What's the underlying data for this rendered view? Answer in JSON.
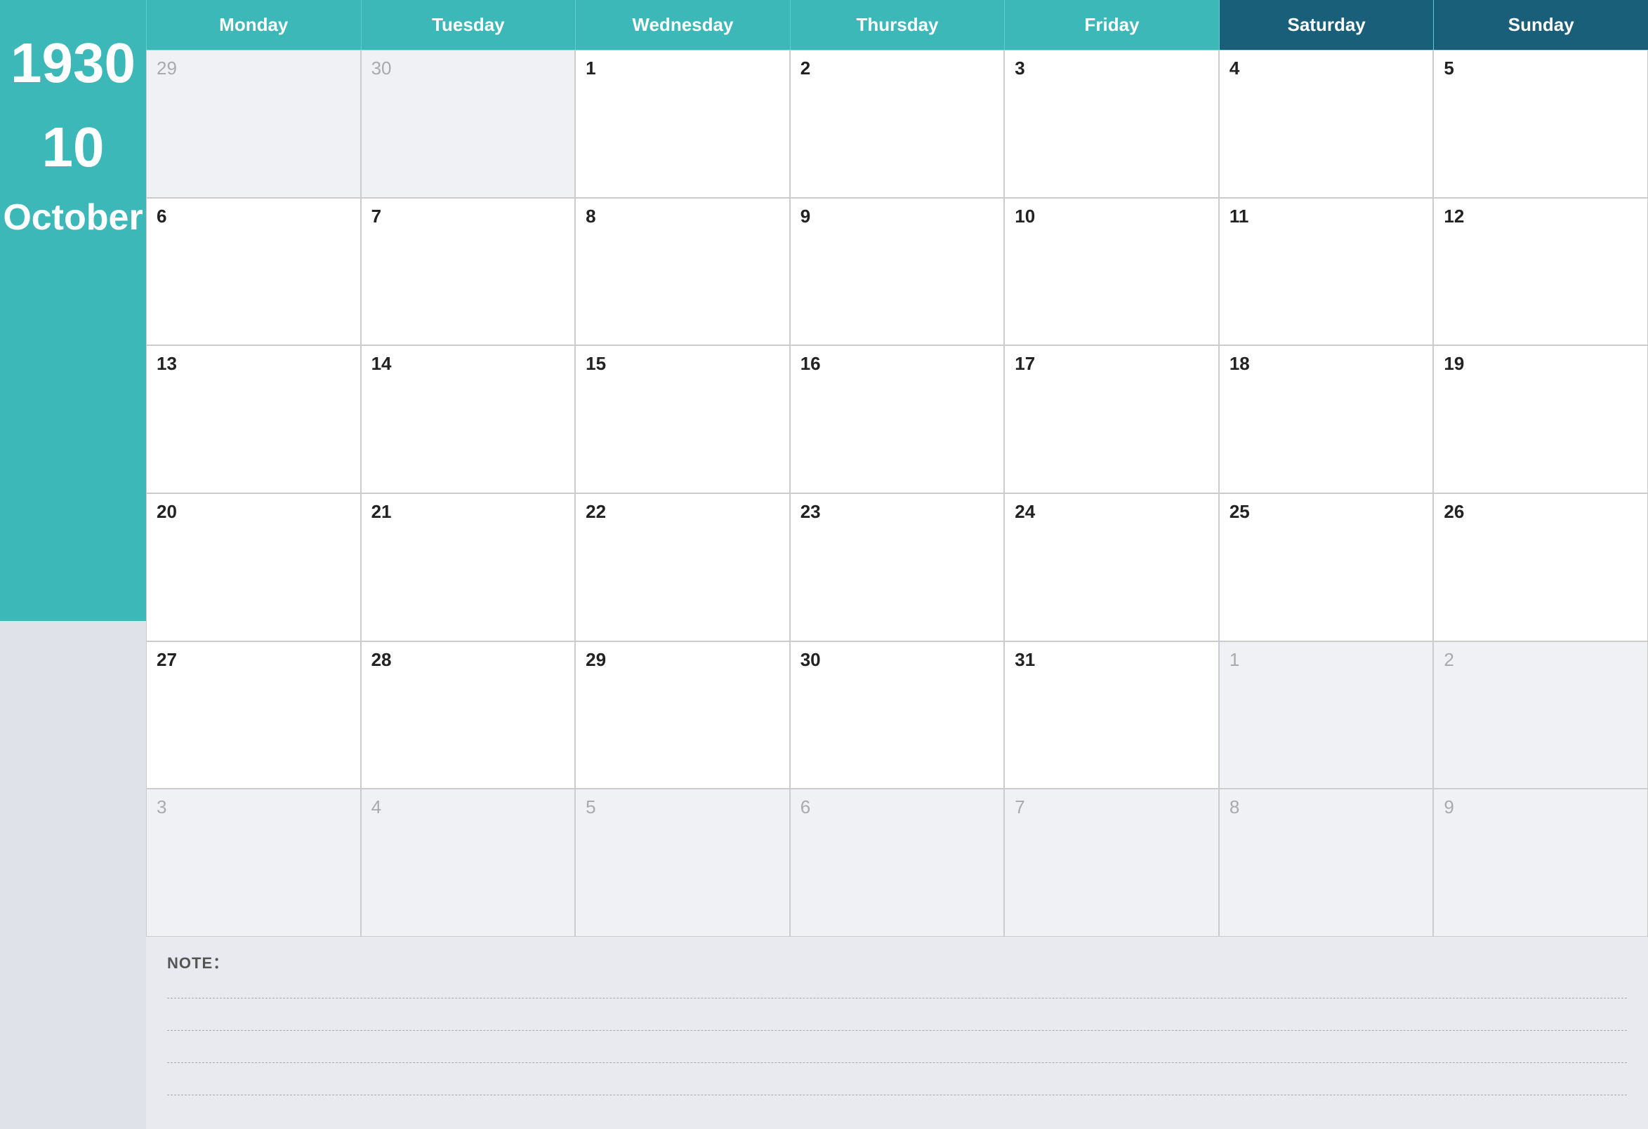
{
  "sidebar": {
    "year": "1930",
    "day_number": "10",
    "month": "October",
    "teal_color": "#3db8b8",
    "dark_blue_color": "#1a5f7a",
    "bg_light": "#e0e2ea"
  },
  "header": {
    "days": [
      {
        "label": "Monday",
        "type": "weekday"
      },
      {
        "label": "Tuesday",
        "type": "weekday"
      },
      {
        "label": "Wednesday",
        "type": "weekday"
      },
      {
        "label": "Thursday",
        "type": "weekday"
      },
      {
        "label": "Friday",
        "type": "weekday"
      },
      {
        "label": "Saturday",
        "type": "weekend"
      },
      {
        "label": "Sunday",
        "type": "weekend"
      }
    ]
  },
  "calendar": {
    "rows": [
      [
        {
          "num": "29",
          "other": true
        },
        {
          "num": "30",
          "other": true
        },
        {
          "num": "1",
          "other": false
        },
        {
          "num": "2",
          "other": false
        },
        {
          "num": "3",
          "other": false
        },
        {
          "num": "4",
          "other": false
        },
        {
          "num": "5",
          "other": false
        }
      ],
      [
        {
          "num": "6",
          "other": false
        },
        {
          "num": "7",
          "other": false
        },
        {
          "num": "8",
          "other": false
        },
        {
          "num": "9",
          "other": false
        },
        {
          "num": "10",
          "other": false
        },
        {
          "num": "11",
          "other": false
        },
        {
          "num": "12",
          "other": false
        }
      ],
      [
        {
          "num": "13",
          "other": false
        },
        {
          "num": "14",
          "other": false
        },
        {
          "num": "15",
          "other": false
        },
        {
          "num": "16",
          "other": false
        },
        {
          "num": "17",
          "other": false
        },
        {
          "num": "18",
          "other": false
        },
        {
          "num": "19",
          "other": false
        }
      ],
      [
        {
          "num": "20",
          "other": false
        },
        {
          "num": "21",
          "other": false
        },
        {
          "num": "22",
          "other": false
        },
        {
          "num": "23",
          "other": false
        },
        {
          "num": "24",
          "other": false
        },
        {
          "num": "25",
          "other": false
        },
        {
          "num": "26",
          "other": false
        }
      ],
      [
        {
          "num": "27",
          "other": false
        },
        {
          "num": "28",
          "other": false
        },
        {
          "num": "29",
          "other": false
        },
        {
          "num": "30",
          "other": false
        },
        {
          "num": "31",
          "other": false
        },
        {
          "num": "1",
          "other": true
        },
        {
          "num": "2",
          "other": true
        }
      ],
      [
        {
          "num": "3",
          "other": true
        },
        {
          "num": "4",
          "other": true
        },
        {
          "num": "5",
          "other": true
        },
        {
          "num": "6",
          "other": true
        },
        {
          "num": "7",
          "other": true
        },
        {
          "num": "8",
          "other": true
        },
        {
          "num": "9",
          "other": true
        }
      ]
    ]
  },
  "notes": {
    "label": "NOTE：",
    "line_count": 4
  }
}
